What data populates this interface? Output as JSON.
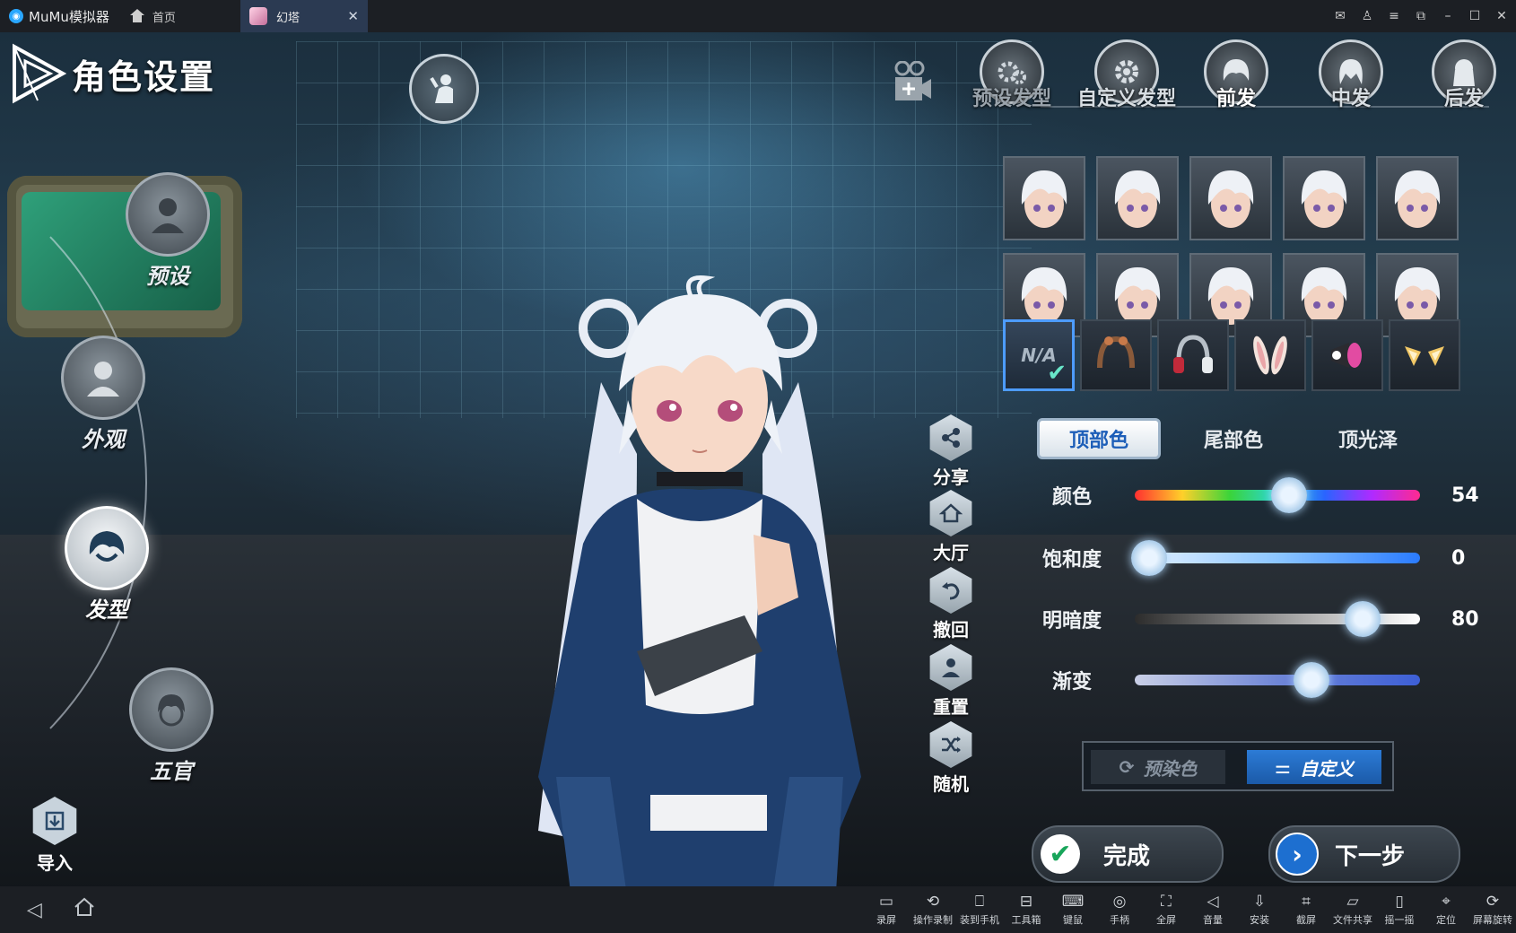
{
  "titlebar": {
    "app_name": "MuMu模拟器",
    "home_label": "首页",
    "tab_label": "幻塔",
    "close_glyph": "✕",
    "window_icons": [
      "mail-icon",
      "user-icon",
      "menu-icon",
      "restore-icon",
      "minimize-icon",
      "maximize-icon",
      "close-icon"
    ]
  },
  "page": {
    "title": "角色设置"
  },
  "left_menu": {
    "items": [
      {
        "label": "预设",
        "icon": "preset-avatar-icon"
      },
      {
        "label": "外观",
        "icon": "appearance-icon"
      },
      {
        "label": "发型",
        "icon": "hair-icon",
        "active": true
      },
      {
        "label": "五官",
        "icon": "face-icon"
      }
    ],
    "import_label": "导入"
  },
  "side_actions": [
    {
      "label": "分享",
      "icon": "share-icon"
    },
    {
      "label": "大厅",
      "icon": "home-icon"
    },
    {
      "label": "撤回",
      "icon": "undo-icon"
    },
    {
      "label": "重置",
      "icon": "reset-person-icon"
    },
    {
      "label": "随机",
      "icon": "shuffle-icon"
    }
  ],
  "hair_tabs": [
    {
      "label": "预设发型",
      "state": "dim"
    },
    {
      "label": "自定义发型",
      "state": "normal"
    },
    {
      "label": "前发",
      "state": "active"
    },
    {
      "label": "中发",
      "state": "normal"
    },
    {
      "label": "后发",
      "state": "normal"
    }
  ],
  "hair_thumbnails_count": 10,
  "accessories": {
    "na_label": "N/A",
    "items": [
      "none",
      "headband-icon",
      "headphones-icon",
      "bunny-ears-icon",
      "megaphone-icon",
      "cat-ears-icon"
    ]
  },
  "color_tabs": [
    {
      "label": "顶部色",
      "active": true
    },
    {
      "label": "尾部色",
      "active": false
    },
    {
      "label": "顶光泽",
      "active": false
    }
  ],
  "sliders": [
    {
      "label": "颜色",
      "value": 54,
      "fraction": 0.54,
      "show_value": true
    },
    {
      "label": "饱和度",
      "value": 0,
      "fraction": 0.05,
      "show_value": true
    },
    {
      "label": "明暗度",
      "value": 80,
      "fraction": 0.8,
      "show_value": true
    },
    {
      "label": "渐变",
      "value": null,
      "fraction": 0.62,
      "show_value": false
    }
  ],
  "color_mode": {
    "preset_label": "预染色",
    "custom_label": "自定义",
    "selected": "custom"
  },
  "actions": {
    "done_label": "完成",
    "next_label": "下一步"
  },
  "bottom_toolbar": [
    {
      "label": "录屏",
      "icon": "record-icon"
    },
    {
      "label": "操作录制",
      "icon": "macro-icon"
    },
    {
      "label": "装到手机",
      "icon": "phone-install-icon"
    },
    {
      "label": "工具箱",
      "icon": "toolbox-icon"
    },
    {
      "label": "键鼠",
      "icon": "keyboard-icon"
    },
    {
      "label": "手柄",
      "icon": "gamepad-icon"
    },
    {
      "label": "全屏",
      "icon": "fullscreen-icon"
    },
    {
      "label": "音量",
      "icon": "volume-icon"
    },
    {
      "label": "安装",
      "icon": "apk-icon"
    },
    {
      "label": "截屏",
      "icon": "crop-icon"
    },
    {
      "label": "文件共享",
      "icon": "folder-icon"
    },
    {
      "label": "摇一摇",
      "icon": "shake-icon"
    },
    {
      "label": "定位",
      "icon": "location-icon"
    },
    {
      "label": "屏幕旋转",
      "icon": "rotate-icon"
    }
  ],
  "colors": {
    "accent_blue": "#1d6fd0",
    "check_green": "#18a55a",
    "selected_border": "#4d9cff"
  }
}
